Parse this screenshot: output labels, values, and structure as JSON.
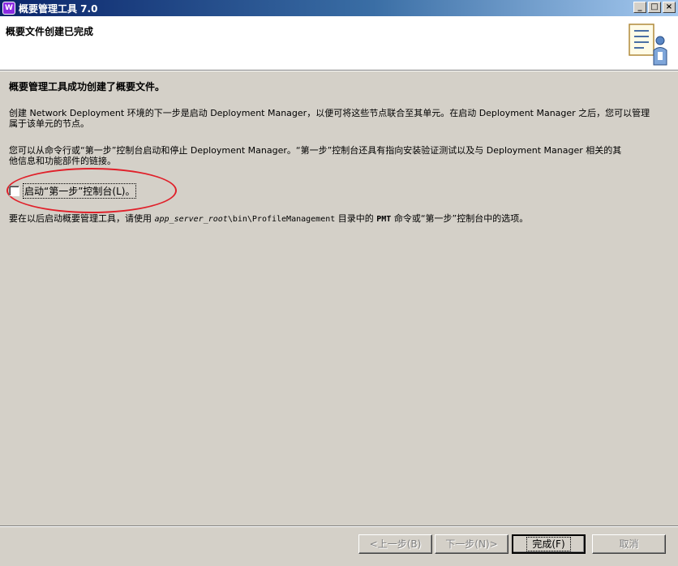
{
  "window": {
    "title": "概要管理工具 7.0",
    "app_icon_text": "W",
    "minimize": "_",
    "maximize": "□",
    "close": "×"
  },
  "header": {
    "title": "概要文件创建已完成",
    "graphic_icon": "wizard-document-person-icon"
  },
  "content": {
    "heading": "概要管理工具成功创建了概要文件。",
    "para1_line1": "创建 Network Deployment 环境的下一步是启动 Deployment Manager，以便可将这些节点联合至其单元。在启动 Deployment Manager 之后，您可以管理",
    "para1_line2": "属于该单元的节点。",
    "para2_line1": "您可以从命令行或“第一步”控制台启动和停止 Deployment Manager。“第一步”控制台还具有指向安装验证测试以及与 Deployment Manager 相关的其",
    "para2_line2": "他信息和功能部件的链接。",
    "checkbox_label": "启动“第一步”控制台(L)。",
    "checkbox_checked": false,
    "para3_prefix": "要在以后启动概要管理工具，请使用 ",
    "para3_path_italic": "app_server_root",
    "para3_path_rest": "\\bin\\ProfileManagement",
    "para3_mid": " 目录中的 ",
    "para3_cmd": "PMT",
    "para3_suffix": " 命令或“第一步”控制台中的选项。"
  },
  "buttons": {
    "back": "<上一步(B)",
    "next": "下一步(N)>",
    "finish": "完成(F)",
    "cancel": "取消"
  },
  "colors": {
    "titlebar_start": "#0a246a",
    "titlebar_end": "#a6caf0",
    "annotation_ellipse": "#e0202a",
    "dialog_bg": "#d4d0c8"
  }
}
